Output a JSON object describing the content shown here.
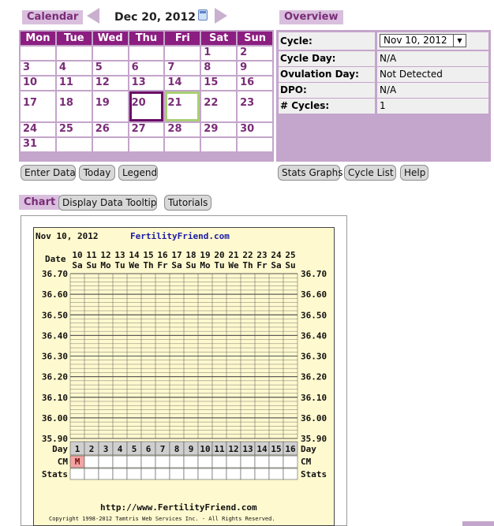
{
  "calendar": {
    "label": "Calendar",
    "month_title": "Dec 20, 2012",
    "weekdays": [
      "Mon",
      "Tue",
      "Wed",
      "Thu",
      "Fri",
      "Sat",
      "Sun"
    ],
    "weeks": [
      [
        "",
        "",
        "",
        "",
        "",
        "1",
        "2"
      ],
      [
        "3",
        "4",
        "5",
        "6",
        "7",
        "8",
        "9"
      ],
      [
        "10",
        "11",
        "12",
        "13",
        "14",
        "15",
        "16"
      ],
      [
        "17",
        "18",
        "19",
        "20",
        "21",
        "22",
        "23"
      ],
      [
        "24",
        "25",
        "26",
        "27",
        "28",
        "29",
        "30"
      ],
      [
        "31",
        "",
        "",
        "",
        "",
        "",
        ""
      ]
    ],
    "today": "20",
    "selected": "21",
    "buttons": [
      "Enter Data",
      "Today",
      "Legend"
    ]
  },
  "overview": {
    "label": "Overview",
    "rows": [
      {
        "key": "Cycle:",
        "value": "Nov 10, 2012"
      },
      {
        "key": "Cycle Day:",
        "value": "N/A"
      },
      {
        "key": "Ovulation Day:",
        "value": "Not Detected"
      },
      {
        "key": "DPO:",
        "value": "N/A"
      },
      {
        "key": "# Cycles:",
        "value": "1"
      }
    ],
    "buttons": [
      "Stats Graphs",
      "Cycle List",
      "Help"
    ]
  },
  "chart_tab": {
    "label": "Chart",
    "buttons": [
      "Display Data Tooltip",
      "Tutorials"
    ]
  },
  "chart": {
    "date": "Nov 10, 2012",
    "site": "FertilityFriend.com",
    "row_labels": {
      "date": "Date",
      "day": "Day",
      "cm": "CM",
      "stats": "Stats"
    },
    "dates": [
      "10",
      "11",
      "12",
      "13",
      "14",
      "15",
      "16",
      "17",
      "18",
      "19",
      "20",
      "21",
      "22",
      "23",
      "24",
      "25"
    ],
    "weekdays": [
      "Sa",
      "Su",
      "Mo",
      "Tu",
      "We",
      "Th",
      "Fr",
      "Sa",
      "Su",
      "Mo",
      "Tu",
      "We",
      "Th",
      "Fr",
      "Sa",
      "Su"
    ],
    "temps": [
      "36.70",
      "36.60",
      "36.50",
      "36.40",
      "36.30",
      "36.20",
      "36.10",
      "36.00",
      "35.90"
    ],
    "days": [
      "1",
      "2",
      "3",
      "4",
      "5",
      "6",
      "7",
      "8",
      "9",
      "10",
      "11",
      "12",
      "13",
      "14",
      "15",
      "16"
    ],
    "cm_mark": "M",
    "url": "http://www.FertilityFriend.com",
    "copyright": "Copyright 1998-2012 Tamtris Web Services Inc. - All Rights Reserved.",
    "colors": {
      "paper": "#fff9cf",
      "grid": "#555555",
      "day_row": "#cfcfcf",
      "menses": "#f4a4a4",
      "site_link": "#1a1aa6"
    }
  }
}
